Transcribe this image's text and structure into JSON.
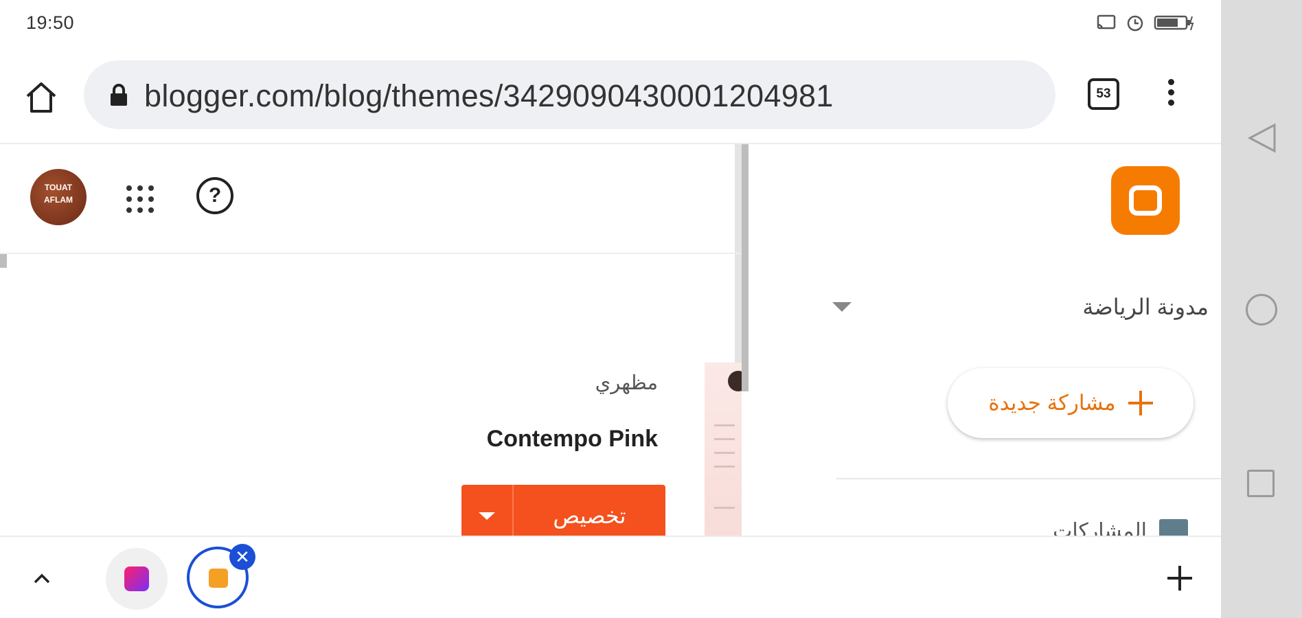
{
  "status_bar": {
    "time": "19:50",
    "icons": [
      "signal-icon",
      "cast-icon",
      "alarm-icon",
      "battery-charging-icon"
    ]
  },
  "browser": {
    "url": "blogger.com/blog/themes/3429090430001204981",
    "tab_count": "53",
    "icons": [
      "home-icon",
      "lock-icon",
      "overflow-menu-icon"
    ]
  },
  "blogger_header": {
    "avatar_text": "TOUAT AFLAM"
  },
  "theme": {
    "section_label": "مظهري",
    "name": "Contempo Pink",
    "customize_label": "تخصيص"
  },
  "sidebar": {
    "blog_name": "مدونة الرياضة",
    "new_post_label": "مشاركة جديدة",
    "posts_label": "المشاركات"
  },
  "tabstrip": {
    "close_symbol": "✕"
  },
  "colors": {
    "accent_orange": "#f4511e",
    "blogger_orange": "#f57c00",
    "tab_active_blue": "#1a4fd6"
  }
}
